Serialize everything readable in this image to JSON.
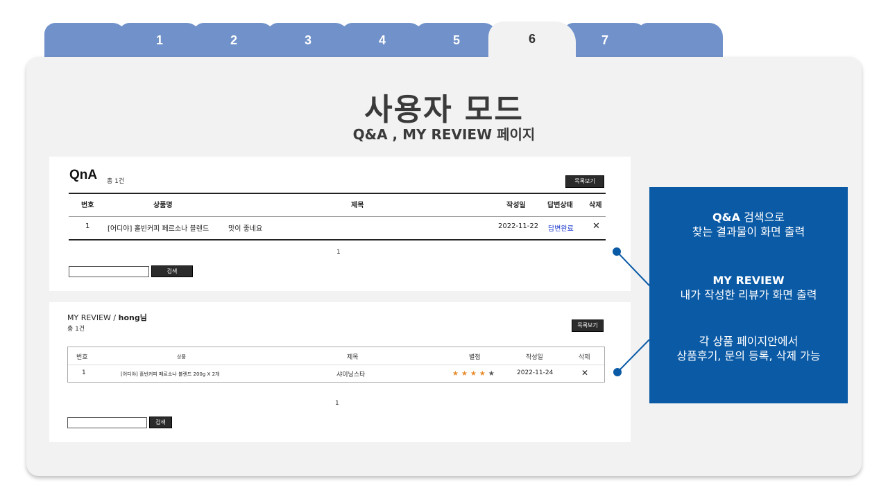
{
  "tabs": [
    {
      "label": ""
    },
    {
      "label": "1"
    },
    {
      "label": "2"
    },
    {
      "label": "3"
    },
    {
      "label": "4"
    },
    {
      "label": "5"
    },
    {
      "label": "6"
    },
    {
      "label": "7"
    },
    {
      "label": ""
    }
  ],
  "active_tab": "6",
  "header": {
    "title": "사용자 모드",
    "subtitle": "Q&A , MY REVIEW 페이지"
  },
  "qna": {
    "title": "QnA",
    "count": "총 1건",
    "list_button": "목록보기",
    "columns": [
      "번호",
      "상품명",
      "제목",
      "작성일",
      "답변상태",
      "삭제"
    ],
    "row": {
      "no": "1",
      "product": "[어디야] 홀빈커피 페르소나 블렌드",
      "subject": "맛이 좋네요",
      "date": "2022-11-22",
      "status": "답변완료",
      "delete": "✕"
    },
    "page": "1",
    "search_button": "검색"
  },
  "review": {
    "title_prefix": "MY REVIEW / ",
    "user": "hong님",
    "count": "총 1건",
    "list_button": "목록보기",
    "columns": [
      "번호",
      "상품",
      "제목",
      "별점",
      "작성일",
      "삭제"
    ],
    "row": {
      "no": "1",
      "product": "[어디야] 홀빈커피 페르소나 블렌드 200g X 2개",
      "subject": "샤이닝스타",
      "rating": 4,
      "rating_max": 5,
      "date": "2022-11-24",
      "delete": "✕"
    },
    "page": "1",
    "search_button": "검색"
  },
  "callout": {
    "block1_bold": "Q&A",
    "block1_rest": " 검색으로",
    "block1_line2": "찾는 결과물이 화면 출력",
    "block2_bold": "MY REVIEW",
    "block2_line2": "내가 작성한 리뷰가 화면 출력",
    "block3_line1": "각 상품 페이지안에서",
    "block3_line2": "상품후기, 문의 등록, 삭제 가능"
  },
  "colors": {
    "tab": "#7091c9",
    "panel": "#f2f2f2",
    "callout": "#0a5aa6",
    "star": "#e8892a",
    "link": "#1f3bd1"
  }
}
